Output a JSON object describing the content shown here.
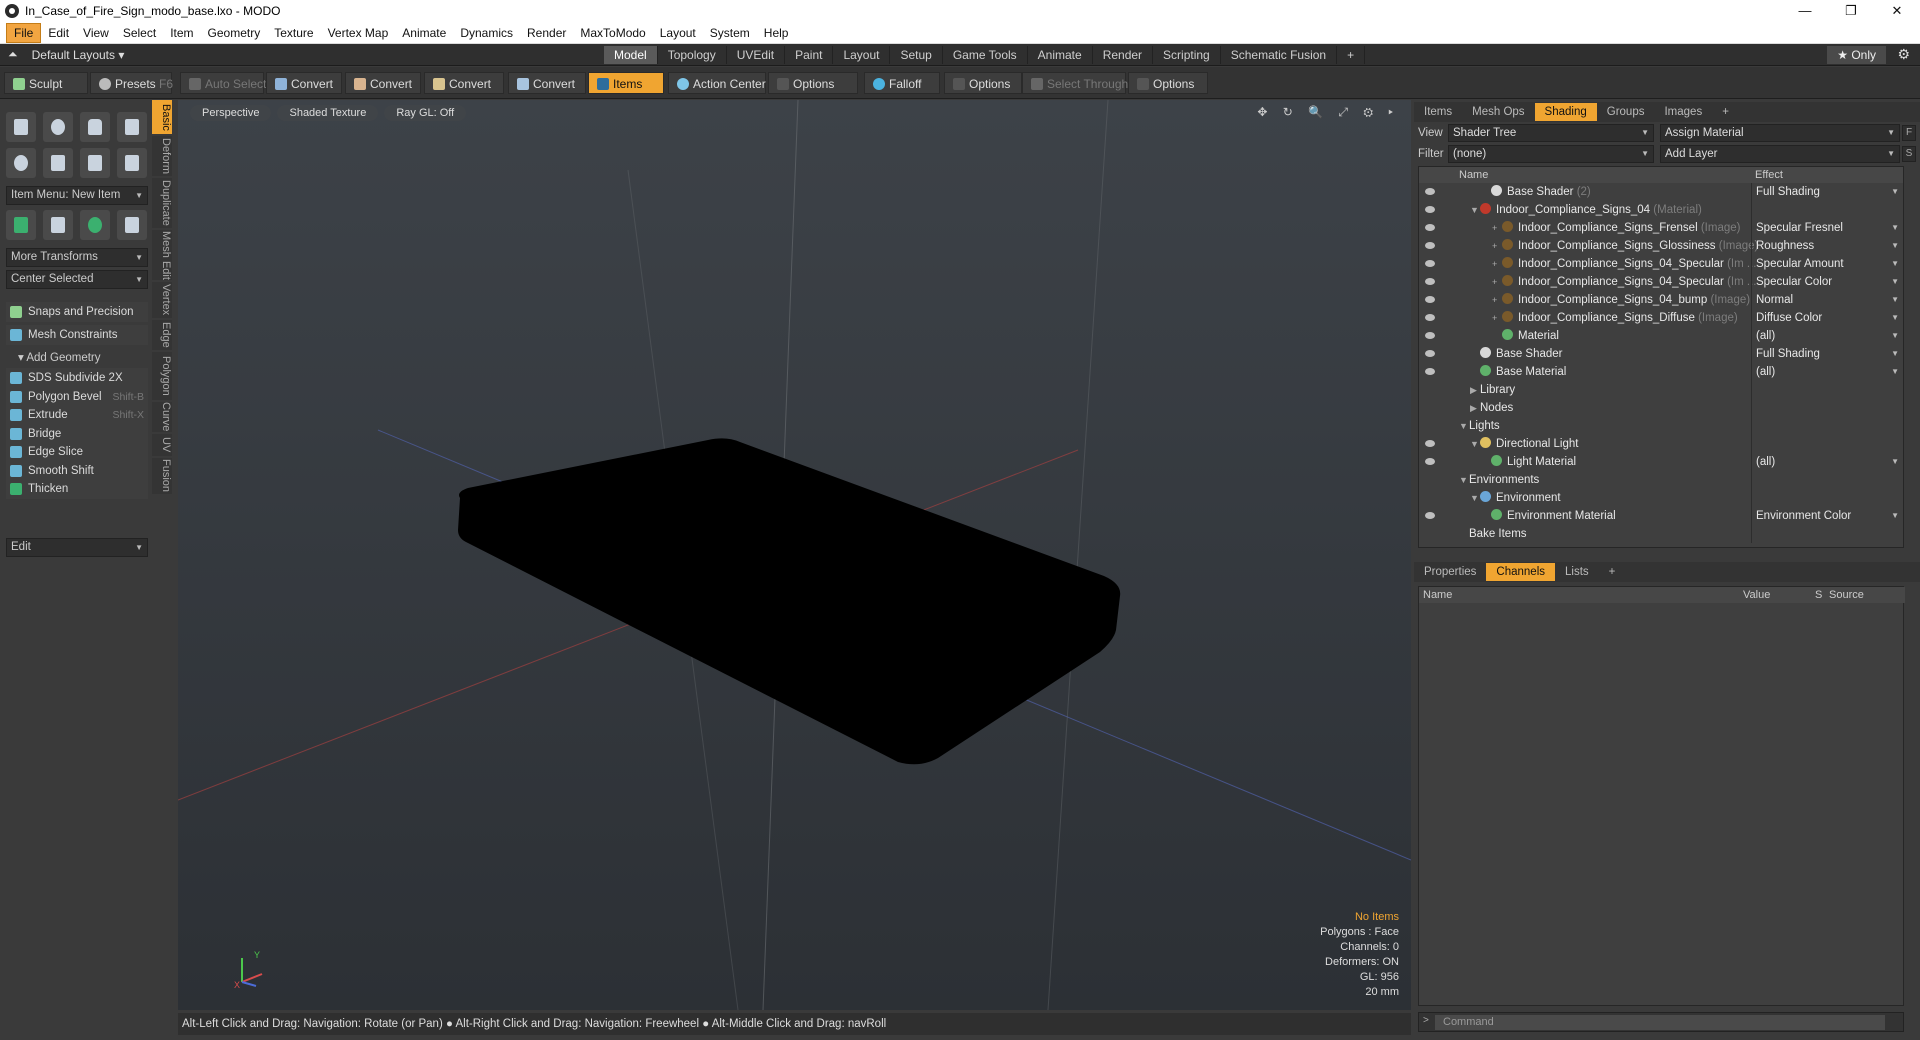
{
  "window": {
    "title": "In_Case_of_Fire_Sign_modo_base.lxo - MODO",
    "minimize": "—",
    "maximize": "❐",
    "close": "✕"
  },
  "menu": [
    "File",
    "Edit",
    "View",
    "Select",
    "Item",
    "Geometry",
    "Texture",
    "Vertex Map",
    "Animate",
    "Dynamics",
    "Render",
    "MaxToModo",
    "Layout",
    "System",
    "Help"
  ],
  "layout_bar": {
    "layouts_label": "Default Layouts",
    "tabs": [
      "Model",
      "Topology",
      "UVEdit",
      "Paint",
      "Layout",
      "Setup",
      "Game Tools",
      "Animate",
      "Render",
      "Scripting",
      "Schematic Fusion"
    ],
    "active_tab": "Model",
    "add": "+",
    "only_label": "Only"
  },
  "toolbar": {
    "sculpt": "Sculpt",
    "presets": "Presets",
    "presets_key": "F6",
    "auto_select": "Auto Select",
    "convert1": "Convert",
    "convert2": "Convert",
    "convert3": "Convert",
    "convert4": "Convert",
    "items": "Items",
    "action_center": "Action Center",
    "options1": "Options",
    "falloff": "Falloff",
    "options2": "Options",
    "select_through": "Select Through",
    "options3": "Options"
  },
  "left_panel": {
    "item_menu": "Item Menu: New Item",
    "more_transforms": "More Transforms",
    "center_selected": "Center Selected",
    "snaps": "Snaps and Precision",
    "mesh_constraints": "Mesh Constraints",
    "add_geometry": "Add Geometry",
    "tools": [
      {
        "label": "SDS Subdivide 2X",
        "shortcut": ""
      },
      {
        "label": "Polygon Bevel",
        "shortcut": "Shift-B"
      },
      {
        "label": "Extrude",
        "shortcut": "Shift-X"
      },
      {
        "label": "Bridge",
        "shortcut": ""
      },
      {
        "label": "Edge Slice",
        "shortcut": ""
      },
      {
        "label": "Smooth Shift",
        "shortcut": ""
      },
      {
        "label": "Thicken",
        "shortcut": ""
      }
    ],
    "edit_dropdown": "Edit",
    "vertical_tabs": [
      "Basic",
      "Deform",
      "Duplicate",
      "Mesh Edit",
      "Vertex",
      "Edge",
      "Polygon",
      "Curve",
      "UV",
      "Fusion"
    ]
  },
  "viewport": {
    "perspective": "Perspective",
    "shaded_texture": "Shaded Texture",
    "ray_gl": "Ray GL: Off",
    "stats": {
      "header": "No Items",
      "polygons": "Polygons : Face",
      "channels": "Channels: 0",
      "deformers": "Deformers: ON",
      "gl": "GL: 956",
      "scale": "20 mm"
    },
    "axis_y": "Y",
    "axis_x": "X"
  },
  "status_line": "Alt-Left Click and Drag: Navigation: Rotate (or Pan) ● Alt-Right Click and Drag: Navigation: Freewheel ● Alt-Middle Click and Drag: navRoll",
  "right_panel": {
    "tabs": [
      "Items",
      "Mesh Ops",
      "Shading",
      "Groups",
      "Images"
    ],
    "active_tab": "Shading",
    "view_label": "View",
    "view_value": "Shader Tree",
    "assign_material": "Assign Material",
    "filter_label": "Filter",
    "filter_value": "(none)",
    "add_layer": "Add Layer",
    "f_btn": "F",
    "s_btn": "S",
    "col_name": "Name",
    "col_effect": "Effect",
    "tree": [
      {
        "name": "Base Shader",
        "sub": "(2)",
        "effect": "Full Shading",
        "indent": 2,
        "ball": "#d8d8d8",
        "eye": true,
        "exp": "",
        "dd": true
      },
      {
        "name": "Indoor_Compliance_Signs_04",
        "sub": "(Material)",
        "effect": "",
        "indent": 1,
        "ball": "#c0392b",
        "eye": true,
        "exp": "▼",
        "dd": false
      },
      {
        "name": "Indoor_Compliance_Signs_Frensel",
        "sub": "(Image)",
        "effect": "Specular Fresnel",
        "indent": 3,
        "ball": "#7a5a2a",
        "eye": true,
        "exp": "+",
        "dd": true
      },
      {
        "name": "Indoor_Compliance_Signs_Glossiness",
        "sub": "(Image)",
        "effect": "Roughness",
        "indent": 3,
        "ball": "#7a5a2a",
        "eye": true,
        "exp": "+",
        "dd": true
      },
      {
        "name": "Indoor_Compliance_Signs_04_Specular",
        "sub": "(Im ...",
        "effect": "Specular Amount",
        "indent": 3,
        "ball": "#7a5a2a",
        "eye": true,
        "exp": "+",
        "dd": true
      },
      {
        "name": "Indoor_Compliance_Signs_04_Specular",
        "sub": "(Im ...",
        "effect": "Specular Color",
        "indent": 3,
        "ball": "#7a5a2a",
        "eye": true,
        "exp": "+",
        "dd": true
      },
      {
        "name": "Indoor_Compliance_Signs_04_bump",
        "sub": "(Image)",
        "effect": "Normal",
        "indent": 3,
        "ball": "#7a5a2a",
        "eye": true,
        "exp": "+",
        "dd": true
      },
      {
        "name": "Indoor_Compliance_Signs_Diffuse",
        "sub": "(Image)",
        "effect": "Diffuse Color",
        "indent": 3,
        "ball": "#7a5a2a",
        "eye": true,
        "exp": "+",
        "dd": true
      },
      {
        "name": "Material",
        "sub": "",
        "effect": "(all)",
        "indent": 3,
        "ball": "#5fb16a",
        "eye": true,
        "exp": "",
        "dd": true
      },
      {
        "name": "Base Shader",
        "sub": "",
        "effect": "Full Shading",
        "indent": 1,
        "ball": "#d8d8d8",
        "eye": true,
        "exp": "",
        "dd": true
      },
      {
        "name": "Base Material",
        "sub": "",
        "effect": "(all)",
        "indent": 1,
        "ball": "#5fb16a",
        "eye": true,
        "exp": "",
        "dd": true
      },
      {
        "name": "Library",
        "sub": "",
        "effect": "",
        "indent": 1,
        "ball": "",
        "eye": false,
        "exp": "▶",
        "dd": false
      },
      {
        "name": "Nodes",
        "sub": "",
        "effect": "",
        "indent": 1,
        "ball": "",
        "eye": false,
        "exp": "▶",
        "dd": false
      },
      {
        "name": "Lights",
        "sub": "",
        "effect": "",
        "indent": 0,
        "ball": "",
        "eye": false,
        "exp": "▼",
        "dd": false
      },
      {
        "name": "Directional Light",
        "sub": "",
        "effect": "",
        "indent": 1,
        "ball": "#e0c060",
        "eye": true,
        "exp": "▼",
        "dd": false
      },
      {
        "name": "Light Material",
        "sub": "",
        "effect": "(all)",
        "indent": 2,
        "ball": "#5fb16a",
        "eye": true,
        "exp": "",
        "dd": true
      },
      {
        "name": "Environments",
        "sub": "",
        "effect": "",
        "indent": 0,
        "ball": "",
        "eye": false,
        "exp": "▼",
        "dd": false
      },
      {
        "name": "Environment",
        "sub": "",
        "effect": "",
        "indent": 1,
        "ball": "#6aa6d8",
        "eye": false,
        "exp": "▼",
        "dd": false
      },
      {
        "name": "Environment Material",
        "sub": "",
        "effect": "Environment Color",
        "indent": 2,
        "ball": "#5fb16a",
        "eye": true,
        "exp": "",
        "dd": true
      },
      {
        "name": "Bake Items",
        "sub": "",
        "effect": "",
        "indent": 0,
        "ball": "",
        "eye": false,
        "exp": "",
        "dd": false
      }
    ],
    "lower_tabs": [
      "Properties",
      "Channels",
      "Lists"
    ],
    "lower_active": "Channels",
    "ch_cols": {
      "name": "Name",
      "value": "Value",
      "s": "S",
      "source": "Source"
    },
    "command_placeholder": "Command"
  }
}
